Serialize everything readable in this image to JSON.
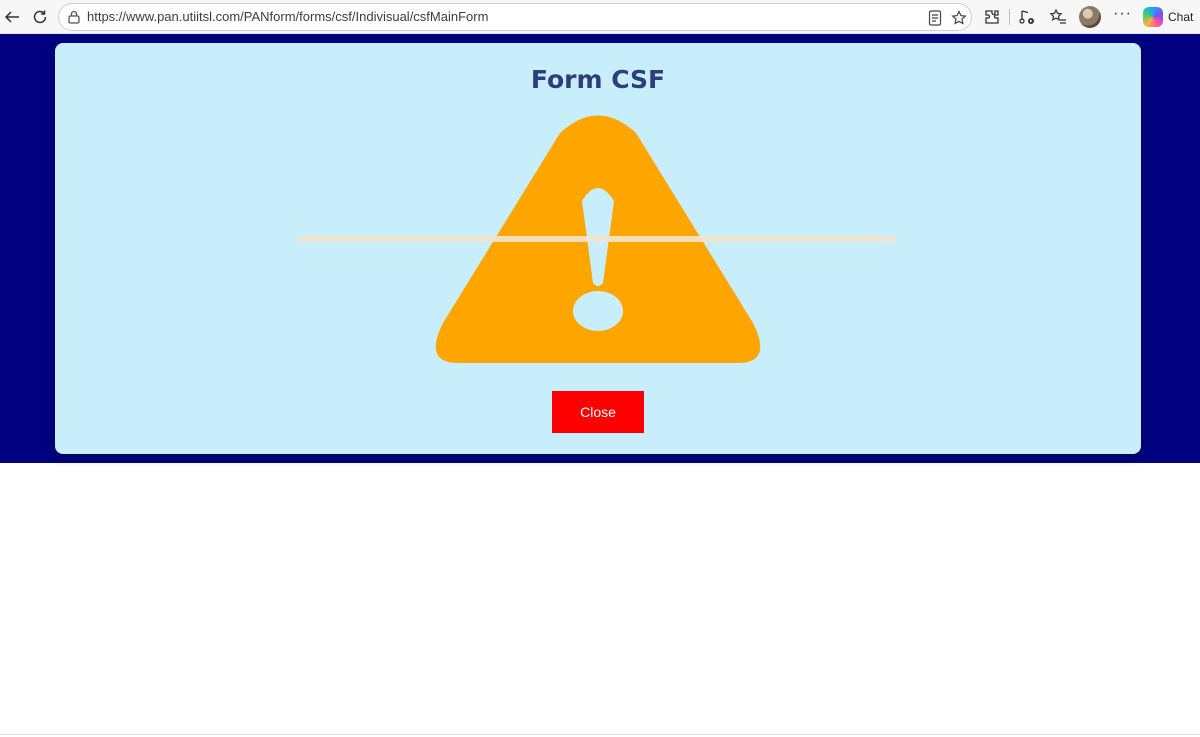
{
  "browser": {
    "url": "https://www.pan.utiitsl.com/PANform/forms/csf/Indivisual/csfMainForm",
    "chat_label": "Chat",
    "more_label": "···",
    "icons": {
      "back": "back-arrow-icon",
      "refresh": "refresh-icon",
      "lock": "lock-icon",
      "reader": "reader-mode-icon",
      "favorite": "star-icon",
      "extensions": "extensions-icon",
      "media": "media-control-icon",
      "favorites_list": "favorites-list-icon",
      "copilot": "copilot-icon"
    }
  },
  "page": {
    "background_color": "#010080",
    "modal": {
      "title": "Form CSF",
      "background_color": "#c8eefb",
      "icon": "warning-triangle-icon",
      "icon_color": "#ffa500",
      "close_label": "Close",
      "close_color": "#ff0000"
    }
  }
}
